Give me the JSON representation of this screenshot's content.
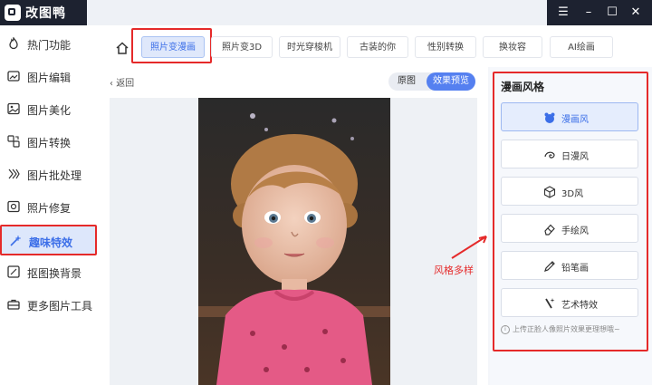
{
  "app": {
    "name": "改图鸭"
  },
  "window_controls": [
    "☰",
    "–",
    "☐",
    "✕"
  ],
  "sidebar": {
    "items": [
      {
        "label": "热门功能",
        "icon": "fire-icon"
      },
      {
        "label": "图片编辑",
        "icon": "image-edit-icon"
      },
      {
        "label": "图片美化",
        "icon": "image-beautify-icon"
      },
      {
        "label": "图片转换",
        "icon": "image-convert-icon"
      },
      {
        "label": "图片批处理",
        "icon": "batch-process-icon"
      },
      {
        "label": "照片修复",
        "icon": "photo-repair-icon"
      },
      {
        "label": "趣味特效",
        "icon": "magic-wand-icon",
        "active": true
      },
      {
        "label": "抠图换背景",
        "icon": "cutout-icon"
      },
      {
        "label": "更多图片工具",
        "icon": "toolbox-icon"
      }
    ]
  },
  "tabs": [
    "照片变漫画",
    "照片变3D",
    "时光穿梭机",
    "古装的你",
    "性别转换",
    "换妆容",
    "AI绘画"
  ],
  "content": {
    "back_label": "返回",
    "toggle": {
      "original": "原图",
      "preview": "效果预览",
      "selected": "效果预览"
    }
  },
  "panel": {
    "title": "漫画风格",
    "styles": [
      {
        "label": "漫画风",
        "icon": "bear-icon",
        "active": true
      },
      {
        "label": "日漫风",
        "icon": "swirl-icon"
      },
      {
        "label": "3D风",
        "icon": "cube-icon"
      },
      {
        "label": "手绘风",
        "icon": "eraser-icon"
      },
      {
        "label": "铅笔画",
        "icon": "pencil-icon"
      },
      {
        "label": "艺术特效",
        "icon": "magic-brush-icon"
      }
    ],
    "hint": "上传正脸人像照片效果更理想哦~"
  },
  "annotation": {
    "text": "风格多样"
  },
  "colors": {
    "accent": "#3b6ee8",
    "highlight": "#e52a2a",
    "titlebar": "#1d2230"
  }
}
